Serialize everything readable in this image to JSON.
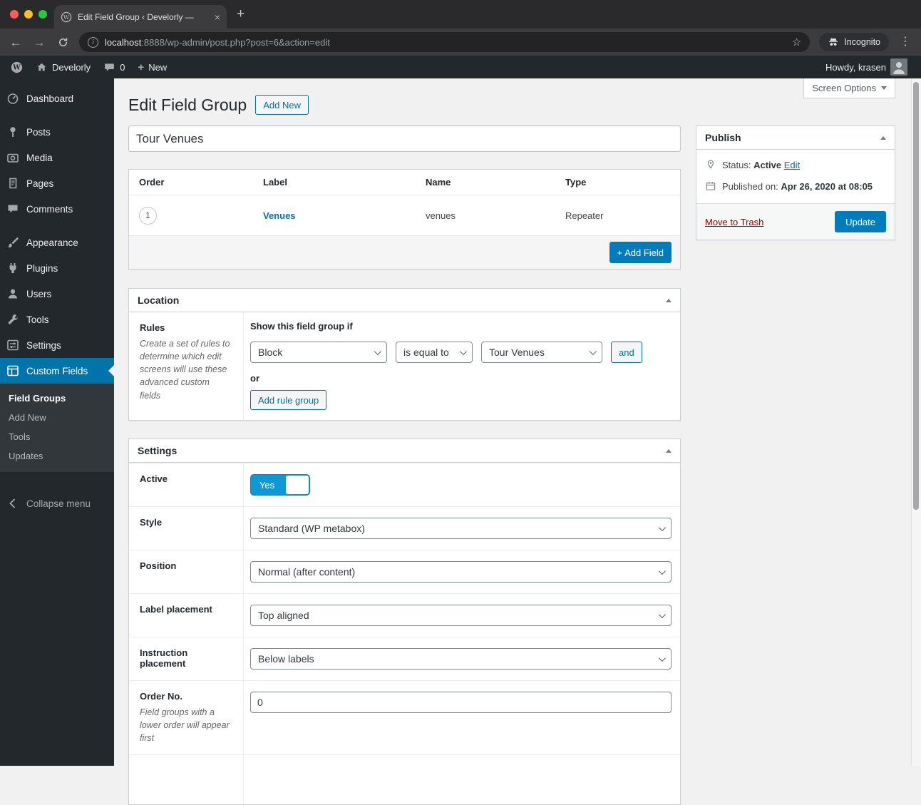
{
  "colors": {
    "accent": "#0073aa",
    "primary_button": "#007cba",
    "link": "#0073aa",
    "trash_link": "#a00000",
    "toggle_on": "#0d99d5",
    "admin_dark": "#23282d"
  },
  "browser": {
    "tab_title": "Edit Field Group ‹ Develorly —",
    "url_host": "localhost",
    "url_path": ":8888/wp-admin/post.php?post=6&action=edit",
    "incognito_label": "Incognito"
  },
  "admin_bar": {
    "site_name": "Develorly",
    "comment_count": "0",
    "new_label": "New",
    "howdy": "Howdy, krasen"
  },
  "sidebar": {
    "items": [
      {
        "label": "Dashboard"
      },
      {
        "label": "Posts"
      },
      {
        "label": "Media"
      },
      {
        "label": "Pages"
      },
      {
        "label": "Comments"
      },
      {
        "label": "Appearance"
      },
      {
        "label": "Plugins"
      },
      {
        "label": "Users"
      },
      {
        "label": "Tools"
      },
      {
        "label": "Settings"
      },
      {
        "label": "Custom Fields"
      }
    ],
    "submenu": [
      {
        "label": "Field Groups"
      },
      {
        "label": "Add New"
      },
      {
        "label": "Tools"
      },
      {
        "label": "Updates"
      }
    ],
    "collapse_label": "Collapse menu"
  },
  "page": {
    "heading": "Edit Field Group",
    "add_new_label": "Add New",
    "screen_options_label": "Screen Options",
    "title_value": "Tour Venues"
  },
  "fields": {
    "headers": [
      "Order",
      "Label",
      "Name",
      "Type"
    ],
    "rows": [
      {
        "order": "1",
        "label": "Venues",
        "name": "venues",
        "type": "Repeater"
      }
    ],
    "add_field_label": "+ Add Field"
  },
  "location": {
    "box_title": "Location",
    "rules_title": "Rules",
    "rules_description": "Create a set of rules to determine which edit screens will use these advanced custom fields",
    "show_if_label": "Show this field group if",
    "rule_param": "Block",
    "rule_operator": "is equal to",
    "rule_value": "Tour Venues",
    "and_label": "and",
    "or_label": "or",
    "add_rule_group_label": "Add rule group"
  },
  "settings": {
    "box_title": "Settings",
    "active_label": "Active",
    "active_value": "Yes",
    "style_label": "Style",
    "style_value": "Standard (WP metabox)",
    "position_label": "Position",
    "position_value": "Normal (after content)",
    "label_placement_label": "Label placement",
    "label_placement_value": "Top aligned",
    "instruction_placement_label": "Instruction placement",
    "instruction_placement_value": "Below labels",
    "order_label": "Order No.",
    "order_description": "Field groups with a lower order will appear first",
    "order_value": "0"
  },
  "publish": {
    "box_title": "Publish",
    "status_label": "Status:",
    "status_value": "Active",
    "edit_label": "Edit",
    "published_label": "Published on:",
    "published_value": "Apr 26, 2020 at 08:05",
    "trash_label": "Move to Trash",
    "update_label": "Update"
  }
}
